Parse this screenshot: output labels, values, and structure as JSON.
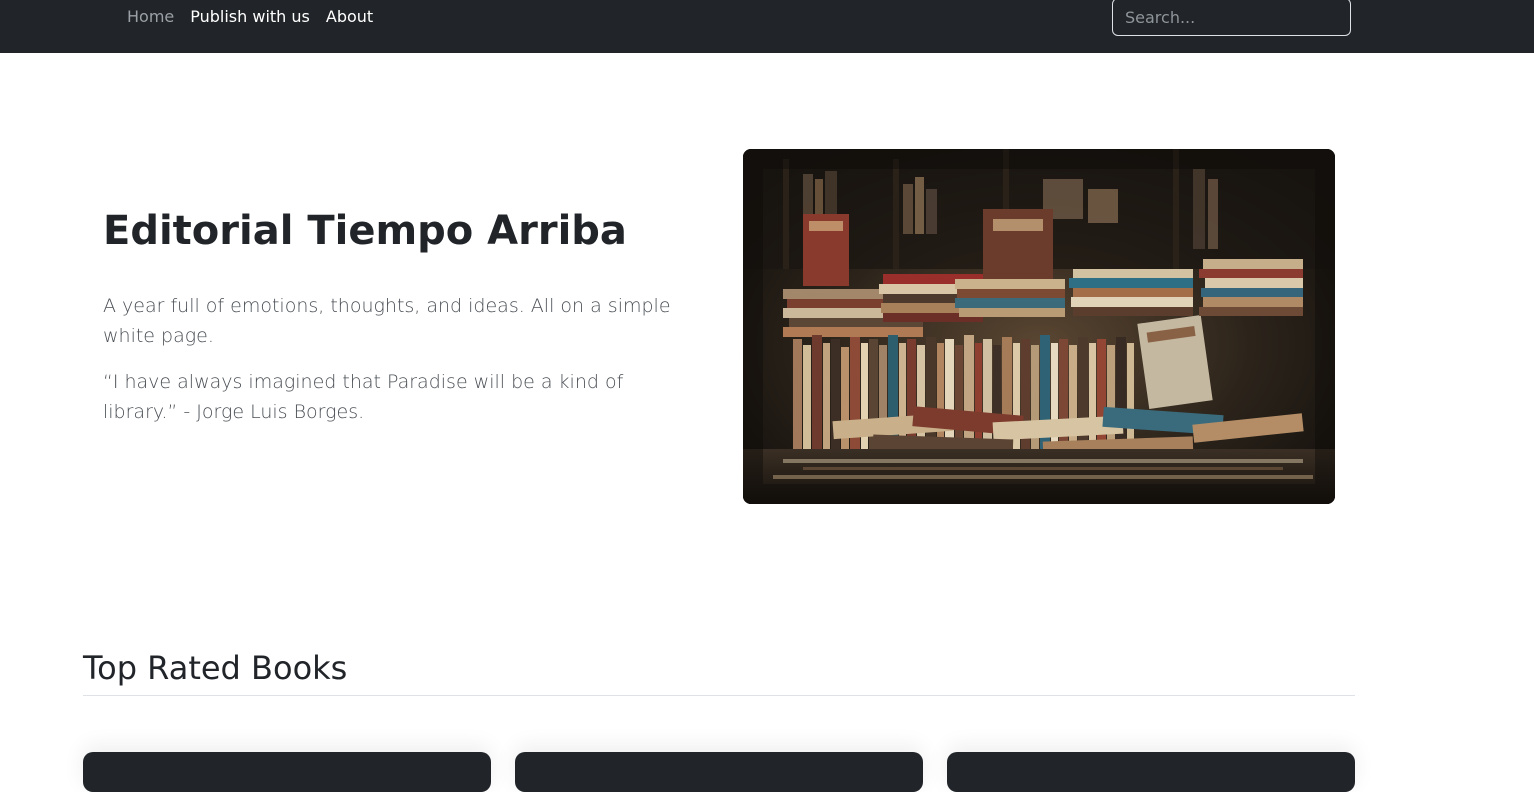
{
  "navbar": {
    "links": [
      {
        "label": "Home",
        "active": false
      },
      {
        "label": "Publish with us"
      },
      {
        "label": "About"
      }
    ],
    "search": {
      "placeholder": "Search...",
      "value": ""
    }
  },
  "hero": {
    "title": "Editorial Tiempo Arriba",
    "paragraph1": "A year full of emotions, thoughts, and ideas. All on a simple white page.",
    "paragraph2": "“I have always imagined that Paradise will be a kind of library.” - Jorge Luis Borges.",
    "image": "bookstore-stacks-photo"
  },
  "top_rated": {
    "title": "Top Rated Books",
    "cards": [
      {
        "name": "book-card-1"
      },
      {
        "name": "book-card-2"
      },
      {
        "name": "book-card-3"
      }
    ]
  },
  "colors": {
    "navbar_bg": "#212529",
    "card_bg": "#212529",
    "text": "#212529",
    "muted_text": "#4a4f55"
  }
}
